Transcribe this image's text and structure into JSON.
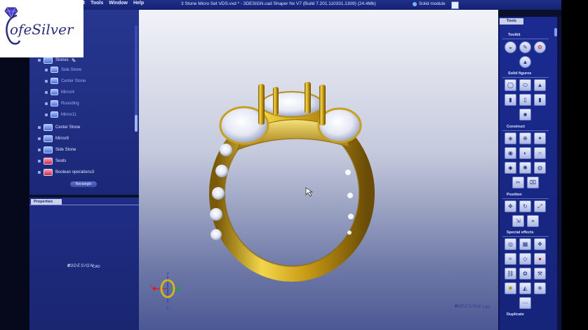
{
  "brand": {
    "name": "ofeSilver"
  },
  "menubar": {
    "items": [
      "rt",
      "Tools",
      "Window",
      "Help"
    ],
    "title": "3 Stone Micro Set VDS.vxd * - 3DESIGN.cad Shaper Nx V7 (Build 7.201.110331.1309) (24.4Mb)",
    "mode": "Solid module"
  },
  "tree": {
    "items": [
      {
        "label": "Stones",
        "level": 0
      },
      {
        "label": "Side Stone",
        "level": 1
      },
      {
        "label": "Center Stone",
        "level": 1
      },
      {
        "label": "Mirror4",
        "level": 1
      },
      {
        "label": "Rounding",
        "level": 1
      },
      {
        "label": "Mirror11",
        "level": 1
      },
      {
        "label": "Center Stone",
        "level": 0
      },
      {
        "label": "Mirror9",
        "level": 0
      },
      {
        "label": "Side Stone",
        "level": 0
      },
      {
        "label": "Seats",
        "level": 0
      },
      {
        "label": "Boolean operations3",
        "level": 0
      }
    ],
    "button": "Rectangle"
  },
  "properties": {
    "tab": "Properties"
  },
  "logo": {
    "brand": "3DESIGN",
    "cad": "CAD"
  },
  "tools": {
    "tab": "Tools",
    "sections": [
      "Toolkit",
      "Solid figures",
      "Construct",
      "Position",
      "Special effects",
      "Duplicate"
    ]
  },
  "axes": {
    "x": "x",
    "y": "Y",
    "z": "Z"
  },
  "colors": {
    "gold": "#d4b21e",
    "panel": "#1e2c86",
    "viewport_top": "#f2f3f8",
    "viewport_bottom": "#4c5894"
  }
}
